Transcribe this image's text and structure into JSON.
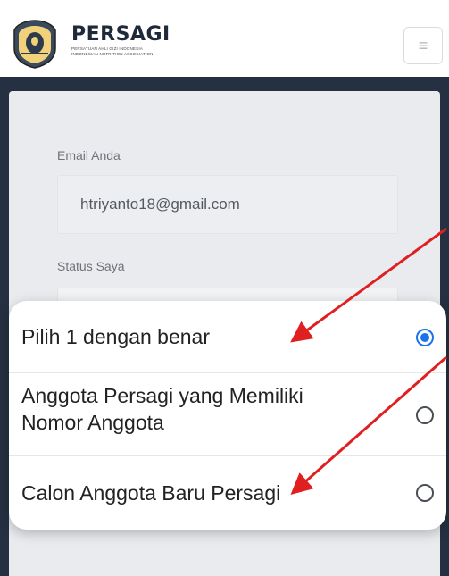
{
  "header": {
    "brand": "PERSAGI",
    "brand_sub1": "PERSATUAN AHLI GIZI INDONESIA",
    "brand_sub2": "INDONESIAN NUTRITION ASSOCIATION",
    "menu_icon": "≡"
  },
  "form": {
    "email_label": "Email Anda",
    "email_value": "htriyanto18@gmail.com",
    "status_label": "Status Saya"
  },
  "picker": {
    "options": [
      {
        "label": "Pilih 1 dengan benar",
        "selected": true
      },
      {
        "label": "Anggota Persagi yang Memiliki Nomor Anggota",
        "line1": "Anggota Persagi yang Memiliki",
        "line2": "Nomor Anggota",
        "selected": false
      },
      {
        "label": "Calon Anggota Baru Persagi",
        "selected": false
      }
    ]
  },
  "colors": {
    "frame": "#253142",
    "accent": "#1a73e8",
    "annotation_arrow": "#e02020"
  }
}
